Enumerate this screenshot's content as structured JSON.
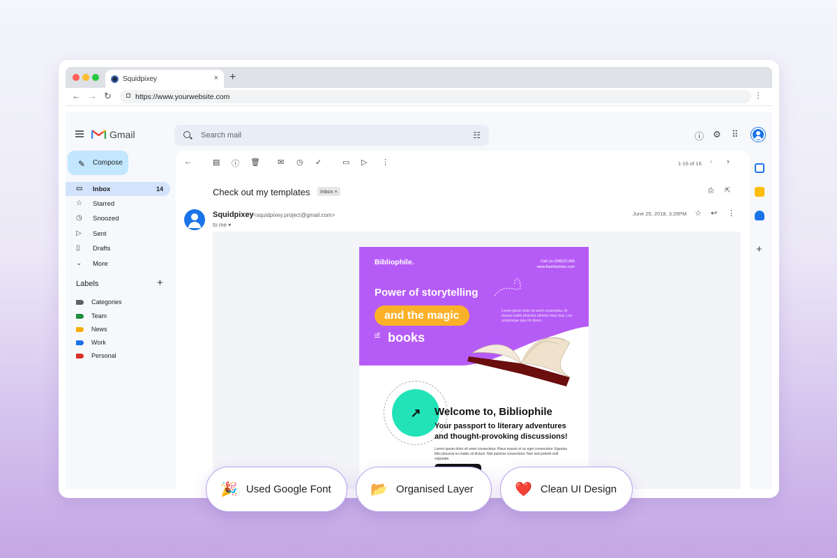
{
  "browser": {
    "tab_title": "Squidpixey",
    "tab_close": "×",
    "new_tab": "+",
    "url": "https://www.yourwebsite.com"
  },
  "gmail": {
    "logo_text": "Gmail",
    "search_placeholder": "Search mail",
    "compose_label": "Compose",
    "sidebar": {
      "items": [
        {
          "label": "Inbox",
          "count": "14",
          "icon": "inbox-icon"
        },
        {
          "label": "Starred",
          "count": "",
          "icon": "star-icon"
        },
        {
          "label": "Snoozed",
          "count": "",
          "icon": "clock-icon"
        },
        {
          "label": "Sent",
          "count": "",
          "icon": "send-icon"
        },
        {
          "label": "Drafts",
          "count": "",
          "icon": "draft-icon"
        },
        {
          "label": "More",
          "count": "",
          "icon": "chevron-down-icon"
        }
      ]
    },
    "labels_heading": "Labels",
    "labels": [
      {
        "name": "Categories",
        "color": "#5f6368"
      },
      {
        "name": "Team",
        "color": "#1e8e3e"
      },
      {
        "name": "News",
        "color": "#f9ab00"
      },
      {
        "name": "Work",
        "color": "#1a73e8"
      },
      {
        "name": "Personal",
        "color": "#d93025"
      }
    ],
    "pager": "1-16 of 16",
    "message": {
      "subject": "Check out my templates",
      "chip": "Inbox ×",
      "sender_name": "Squidpixey",
      "sender_email": "<squidpixey.project@gmail.com>",
      "to_line": "to me",
      "date": "June 25, 2018, 3:26PM"
    }
  },
  "email": {
    "brand": "Bibliophile.",
    "call_us": "Call Us (348)23,405",
    "site": "www.flashfashion.com",
    "headline_1": "Power of storytelling",
    "headline_pill": "and the magic",
    "headline_off": "off",
    "headline_3": "books",
    "hero_text": "Lorem ipsum dolor sit amet consectetur. At massa mattis pharetra ultricies risus duis. Leo scelerisque quis mi donec.",
    "circle_text": "A WORLD OF WORDS TOGETHER LET'S DIVE INTO",
    "welcome": "Welcome to, Bibliophile",
    "passport": "Your passport to literary adventures and thought-provoking discussions!",
    "body_text": "Lorem ipsum dolor sit amet consectetur. Risus mauris et ac eget consectetur. Egestas felis placerat eu mattis sit dictum. Nisl pulvinar consectetur. Non sed potenti velit vulputate.",
    "colors": {
      "purple": "#b65cf6",
      "orange": "#fbb127",
      "teal": "#22e3b8"
    }
  },
  "features": [
    {
      "emoji": "🎉",
      "label": "Used Google Font"
    },
    {
      "emoji": "📂",
      "label": "Organised Layer"
    },
    {
      "emoji": "❤️",
      "label": "Clean UI Design"
    }
  ]
}
